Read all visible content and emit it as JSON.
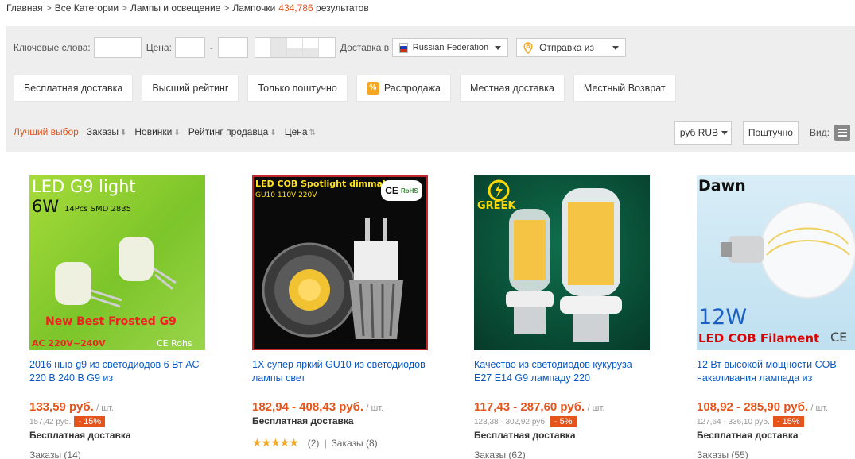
{
  "breadcrumb": {
    "home": "Главная",
    "all": "Все Категории",
    "cat": "Лампы и освещение",
    "current": "Лампочки",
    "count": "434,786",
    "results": "результатов"
  },
  "filters": {
    "keywords_label": "Ключевые слова:",
    "price_label": "Цена:",
    "price_sep": "-",
    "delivery_label": "Доставка в",
    "country": "Russian Federation",
    "ship_from": "Отправка из"
  },
  "chips": {
    "free": "Бесплатная доставка",
    "top": "Высший рейтинг",
    "piece": "Только поштучно",
    "sale": "Распродажа",
    "sale_icon": "%",
    "local": "Местная доставка",
    "return": "Местный Возврат"
  },
  "sort": {
    "best": "Лучший выбор",
    "orders": "Заказы",
    "new": "Новинки",
    "seller": "Рейтинг продавца",
    "price": "Цена",
    "currency": "руб RUB",
    "per_piece": "Поштучно",
    "view": "Вид:"
  },
  "colors": {
    "accent": "#e5541b",
    "link": "#0a59c2"
  },
  "products": [
    {
      "title": "2016 нью-g9 из светодиодов 6 Вт AC 220 В 240 В G9 из",
      "price": "133,59 руб.",
      "unit": "/ шт.",
      "old_price": "157,42 руб.",
      "discount": "- 15%",
      "shipping": "Бесплатная доставка",
      "orders": "Заказы (14)",
      "img": {
        "l1": "LED G9 light",
        "l2": "6W",
        "l2b": "14Pcs SMD 2835",
        "l3": "New Best Frosted G9",
        "l4": "AC 220V~240V",
        "l5": "CE Rohs"
      }
    },
    {
      "title": "1X супер яркий GU10 из светодиодов лампы свет",
      "price": "182,94 - 408,43 руб.",
      "unit": "/ шт.",
      "shipping": "Бесплатная доставка",
      "stars": "★★★★★",
      "reviews": "(2)",
      "sep": "|",
      "orders": "Заказы (8)",
      "img": {
        "l1": "LED COB Spotlight  dimmable",
        "l2": "GU10 110V 220V",
        "l3": "CE",
        "l4": "RoHS"
      }
    },
    {
      "title": "Качество из светодиодов кукуруза E27 E14 G9 лампаду 220",
      "price": "117,43 - 287,60 руб.",
      "unit": "/ шт.",
      "old_price": "123,38 - 302,92 руб.",
      "discount": "- 5%",
      "shipping": "Бесплатная доставка",
      "orders": "Заказы (62)",
      "img": {
        "l1": "GREEK"
      }
    },
    {
      "title": "12 Вт высокой мощности COB накаливания лампада из",
      "price": "108,92 - 285,90 руб.",
      "unit": "/ шт.",
      "old_price": "127,64 - 336,10 руб.",
      "discount": "- 15%",
      "shipping": "Бесплатная доставка",
      "orders": "Заказы (55)",
      "img": {
        "l1": "Dawn",
        "l2": "12W",
        "l3": "LED COB Filament",
        "l4": "CE"
      }
    }
  ]
}
